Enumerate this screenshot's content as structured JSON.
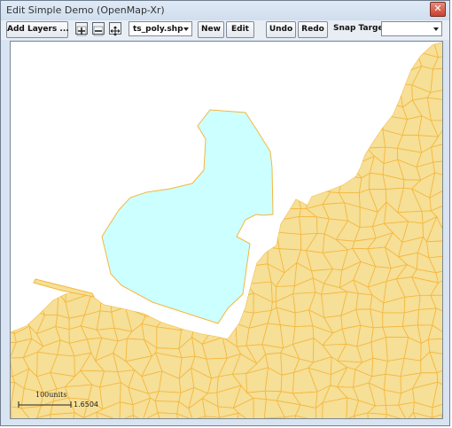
{
  "window": {
    "title": "Edit Simple Demo (OpenMap-Xr)",
    "close_glyph": "✕"
  },
  "toolbar": {
    "add_layers": "Add Layers ...",
    "layer_select": "ts_poly.shp",
    "new": "New",
    "edit": "Edit",
    "undo": "Undo",
    "redo": "Redo",
    "snap_target_label": "Snap Target",
    "snap_target_value": ""
  },
  "map": {
    "scale_label": "100units",
    "scale_value": "1.6504",
    "colors": {
      "land_fill": "#f6df96",
      "land_stroke": "#f4b73c",
      "selected_fill": "#ccffff",
      "selected_stroke": "#f4b73c"
    }
  }
}
